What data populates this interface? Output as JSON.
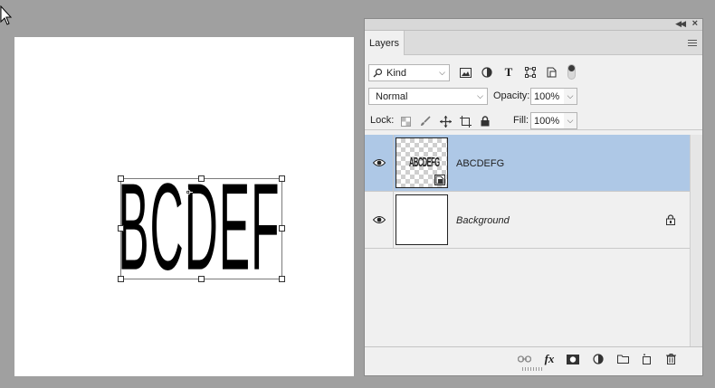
{
  "panel": {
    "tab_label": "Layers",
    "filter": {
      "kind_label": "Kind"
    },
    "blend_mode": "Normal",
    "opacity_label": "Opacity:",
    "opacity_value": "100%",
    "lock_label": "Lock:",
    "fill_label": "Fill:",
    "fill_value": "100%"
  },
  "canvas": {
    "text": "ABCDEFG"
  },
  "layers": [
    {
      "name": "ABCDEFG",
      "selected": true,
      "thumb_text": "ABCDEFG"
    },
    {
      "name": "Background",
      "selected": false,
      "locked": true
    }
  ],
  "colors": {
    "selection": "#aec8e6",
    "panel_bg": "#f0f0f0",
    "workspace": "#a0a0a0"
  }
}
